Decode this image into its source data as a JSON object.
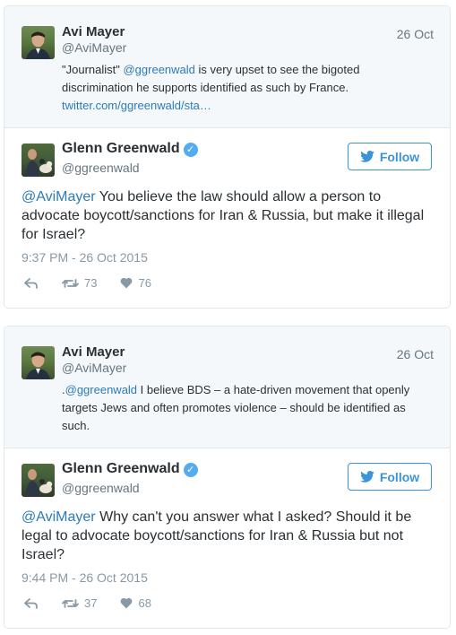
{
  "threads": [
    {
      "quoted": {
        "name": "Avi Mayer",
        "handle": "@AviMayer",
        "date": "26 Oct",
        "text_1": "\"Journalist\" ",
        "mention": "@ggreenwald",
        "text_2": " is very upset to see the bigoted discrimination he supports identified as such by France.",
        "link": "twitter.com/ggreenwald/sta…"
      },
      "tweet": {
        "name": "Glenn Greenwald",
        "handle": "@ggreenwald",
        "follow_label": "Follow",
        "mention": "@AviMayer",
        "text": " You believe the law should allow a person to advocate boycott/sanctions for Iran & Russia, but make it illegal for Israel?",
        "timestamp": "9:37 PM - 26 Oct 2015",
        "retweets": "73",
        "likes": "76"
      }
    },
    {
      "quoted": {
        "name": "Avi Mayer",
        "handle": "@AviMayer",
        "date": "26 Oct",
        "text_1": ".",
        "mention": "@ggreenwald",
        "text_2": " I believe BDS – a hate-driven movement that openly targets Jews and often promotes violence – should be identified as such.",
        "link": ""
      },
      "tweet": {
        "name": "Glenn Greenwald",
        "handle": "@ggreenwald",
        "follow_label": "Follow",
        "mention": "@AviMayer",
        "text": " Why can't you answer what I asked? Should it be legal to advocate boycott/sanctions for Iran & Russia but not Israel?",
        "timestamp": "9:44 PM - 26 Oct 2015",
        "retweets": "37",
        "likes": "68"
      }
    }
  ],
  "icons": {
    "verified": "verified-badge-icon",
    "twitter_bird": "twitter-bird-icon",
    "reply": "reply-icon",
    "retweet": "retweet-icon",
    "like": "heart-icon"
  },
  "colors": {
    "link": "#2b7bb9",
    "follow": "#3b94d9",
    "verified": "#55acee",
    "muted": "#8899a6"
  }
}
